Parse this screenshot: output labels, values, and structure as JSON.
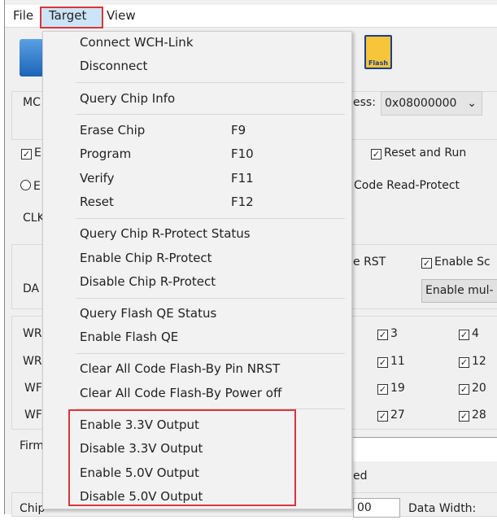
{
  "menubar": {
    "file": "File",
    "target": "Target",
    "view": "View"
  },
  "toolbar": {
    "flash_icon_label": "Flash"
  },
  "background": {
    "mcu_label": "MC",
    "address_label": "ess:",
    "address_value": "0x08000000",
    "checkbox_e": "E",
    "reset_and_run": "Reset and Run",
    "radio_e": "E",
    "code_read_protect": "Code Read-Protect",
    "clk_label": "CLK",
    "rst_label": "e RST",
    "enable_sc": "Enable Sc",
    "enable_mul_button": "Enable mul-",
    "da_label": "DA",
    "wr_labels": [
      "WR",
      "WR",
      "WF",
      "WF"
    ],
    "sector_checks": [
      [
        "3",
        "4"
      ],
      [
        "11",
        "12"
      ],
      [
        "19",
        "20"
      ],
      [
        "27",
        "28"
      ]
    ],
    "firmware_label": "Firm",
    "status_fragment": "ed",
    "chip_label": "Chip",
    "input_fragment": "00",
    "data_width_label": "Data Width:"
  },
  "menu": {
    "items": [
      {
        "label": "Connect  WCH-Link"
      },
      {
        "label": "Disconnect"
      },
      {
        "label": "Query Chip Info"
      },
      {
        "label": "Erase Chip",
        "shortcut": "F9"
      },
      {
        "label": "Program",
        "shortcut": "F10"
      },
      {
        "label": "Verify",
        "shortcut": "F11"
      },
      {
        "label": "Reset",
        "shortcut": "F12"
      },
      {
        "label": "Query Chip R-Protect Status"
      },
      {
        "label": "Enable Chip R-Protect"
      },
      {
        "label": "Disable Chip R-Protect"
      },
      {
        "label": "Query Flash QE Status"
      },
      {
        "label": "Enable Flash QE"
      },
      {
        "label": "Clear All Code Flash-By Pin NRST"
      },
      {
        "label": "Clear All Code Flash-By Power off"
      },
      {
        "label": "Enable 3.3V Output"
      },
      {
        "label": "Disable 3.3V Output"
      },
      {
        "label": "Enable 5.0V Output"
      },
      {
        "label": "Disable 5.0V Output"
      }
    ]
  },
  "colors": {
    "highlight": "#d9353a",
    "menu_hover": "#cce4f7"
  }
}
